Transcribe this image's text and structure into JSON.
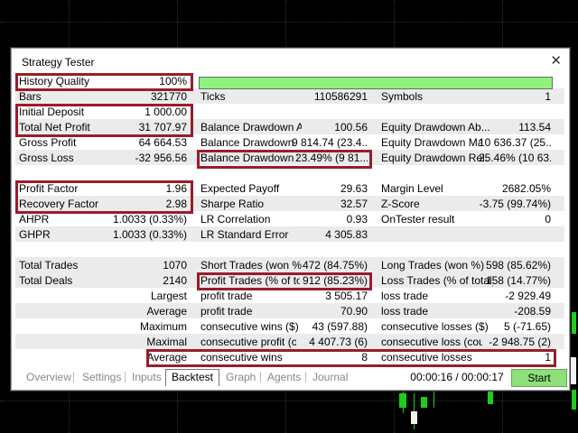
{
  "window": {
    "title": "Strategy Tester",
    "close_glyph": "✕"
  },
  "history_quality": {
    "label": "History Quality",
    "value": "100%"
  },
  "rows": {
    "bars": {
      "l1": "Bars",
      "v1": "321770",
      "l2": "Ticks",
      "v2": "110586291",
      "l3": "Symbols",
      "v3": "1"
    },
    "init": {
      "l1": "Initial Deposit",
      "v1": "1 000.00"
    },
    "netp": {
      "l1": "Total Net Profit",
      "v1": "31 707.97",
      "l2": "Balance Drawdown A...",
      "v2": "100.56",
      "l3": "Equity Drawdown Ab...",
      "v3": "113.54"
    },
    "gp": {
      "l1": "Gross Profit",
      "v1": "64 664.53",
      "l2": "Balance Drawdown ...",
      "v2": "9 814.74 (23.4...",
      "l3": "Equity Drawdown Ma...",
      "v3": "10 636.37 (25...."
    },
    "gl": {
      "l1": "Gross Loss",
      "v1": "-32 956.56",
      "l2": "Balance Drawdown R...",
      "v2": "23.49% (9 81...",
      "l3": "Equity Drawdown Rel...",
      "v3": "25.46% (10 63..."
    },
    "pf": {
      "l1": "Profit Factor",
      "v1": "1.96",
      "l2": "Expected Payoff",
      "v2": "29.63",
      "l3": "Margin Level",
      "v3": "2682.05%"
    },
    "rf": {
      "l1": "Recovery Factor",
      "v1": "2.98",
      "l2": "Sharpe Ratio",
      "v2": "32.57",
      "l3": "Z-Score",
      "v3": "-3.75 (99.74%)"
    },
    "ahpr": {
      "l1": "AHPR",
      "v1": "1.0033 (0.33%)",
      "l2": "LR Correlation",
      "v2": "0.93",
      "l3": "OnTester result",
      "v3": "0"
    },
    "ghpr": {
      "l1": "GHPR",
      "v1": "1.0033 (0.33%)",
      "l2": "LR Standard Error",
      "v2": "4 305.83"
    },
    "tt": {
      "l1": "Total Trades",
      "v1": "1070",
      "l2": "Short Trades (won %)",
      "v2": "472 (84.75%)",
      "l3": "Long Trades (won %)",
      "v3": "598 (85.62%)"
    },
    "td": {
      "l1": "Total Deals",
      "v1": "2140",
      "l2": "Profit Trades (% of to...",
      "v2": "912 (85.23%)",
      "l3": "Loss Trades (% of total)",
      "v3": "158 (14.77%)"
    },
    "lg": {
      "l1": "Largest",
      "l2": "profit trade",
      "v2": "3 505.17",
      "l3": "loss trade",
      "v3": "-2 929.49"
    },
    "av": {
      "l1": "Average",
      "l2": "profit trade",
      "v2": "70.90",
      "l3": "loss trade",
      "v3": "-208.59"
    },
    "mx": {
      "l1": "Maximum",
      "l2": "consecutive wins ($)",
      "v2": "43 (597.88)",
      "l3": "consecutive losses ($)",
      "v3": "5 (-71.65)"
    },
    "ml": {
      "l1": "Maximal",
      "l2": "consecutive profit (c...",
      "v2": "4 407.73 (6)",
      "l3": "consecutive loss (cou...",
      "v3": "-2 948.75 (2)"
    },
    "ac": {
      "l1": "Average",
      "l2": "consecutive wins",
      "v2": "8",
      "l3": "consecutive losses",
      "v3": "1"
    }
  },
  "tabs": [
    "Overview",
    "Settings",
    "Inputs",
    "Backtest",
    "Graph",
    "Agents",
    "Journal"
  ],
  "active_tab": "Backtest",
  "timer": "00:00:16 / 00:00:17",
  "start_label": "Start",
  "colors": {
    "highlight": "#9b1c2a",
    "quality_bar": "#8ef27c",
    "start_button": "#8ee07a",
    "chart_candle": "#1ecb1e"
  }
}
